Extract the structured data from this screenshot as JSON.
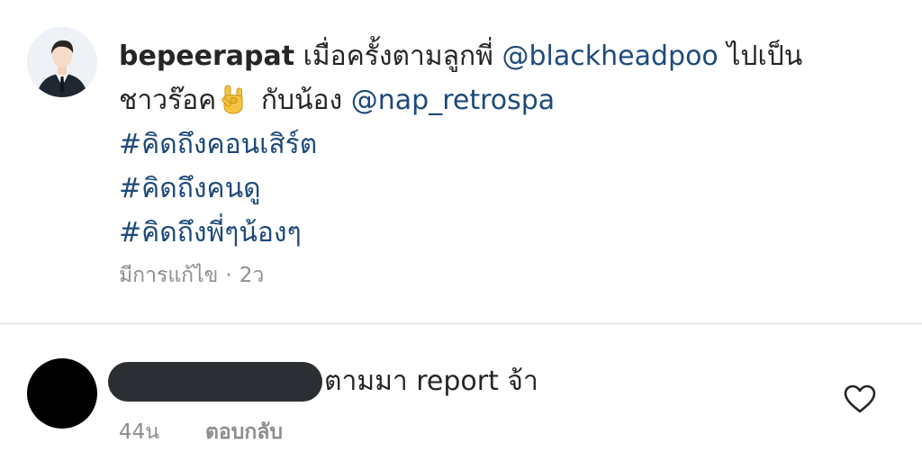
{
  "post": {
    "username": "bepeerapat",
    "caption_line1_text": "เมื่อครั้งตามลูกพี่",
    "mention_1": "@blackheadpoo",
    "caption_line1_tail": "ไปเป็น",
    "caption_line2_text": "ชาวร๊อค",
    "emoji": "rock-hand-emoji",
    "caption_line2_mid": "กับน้อง",
    "mention_2": "@nap_retrospa",
    "hashtags": [
      "#คิดถึงคอนเสิร์ต",
      "#คิดถึงคนดู",
      "#คิดถึงพี่ๆน้องๆ"
    ],
    "edited_label": "มีการแก้ไข",
    "separator": "·",
    "time": "2ว"
  },
  "comment": {
    "text": "ตามมา  report จ้า",
    "time": "44น",
    "reply_label": "ตอบกลับ",
    "like_icon": "heart-outline-icon"
  },
  "colors": {
    "link": "#1e4a7a",
    "meta": "#8e8e8e",
    "text": "#262626",
    "divider": "#dbdbdb"
  }
}
